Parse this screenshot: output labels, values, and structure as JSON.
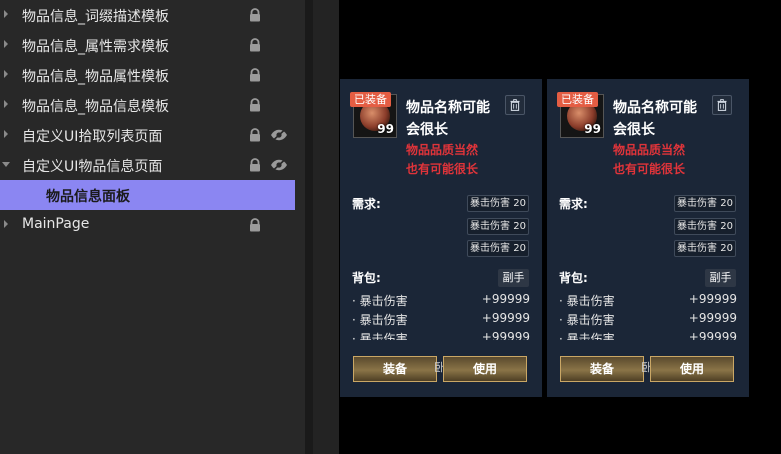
{
  "sidebar": {
    "items": [
      {
        "label": "物品信息_词缀描述模板"
      },
      {
        "label": "物品信息_属性需求模板"
      },
      {
        "label": "物品信息_物品属性模板"
      },
      {
        "label": "物品信息_物品信息模板"
      },
      {
        "label": "自定义UI拾取列表页面"
      },
      {
        "label": "自定义UI物品信息页面"
      },
      {
        "label": "物品信息面板"
      },
      {
        "label": "MainPage"
      }
    ]
  },
  "cards": [
    {
      "equipped_badge": "已装备",
      "quantity": "99",
      "name": "物品名称可能会很长",
      "quality_line1": "物品品质当然",
      "quality_line2": "也有可能很长",
      "requirements_label": "需求:",
      "requirements": [
        "暴击伤害 20",
        "暴击伤害 20",
        "暴击伤害 20"
      ],
      "bag_label": "背包:",
      "sub_badge": "副手",
      "stats": [
        {
          "name": "· 暴击伤害",
          "value": "+99999"
        },
        {
          "name": "· 暴击伤害",
          "value": "+99999"
        },
        {
          "name": "· 暴击伤害",
          "value": "+99999"
        }
      ],
      "equip_button": "装备",
      "button_fragment": "卧",
      "use_button": "使用"
    },
    {
      "equipped_badge": "已装备",
      "quantity": "99",
      "name": "物品名称可能会很长",
      "quality_line1": "物品品质当然",
      "quality_line2": "也有可能很长",
      "requirements_label": "需求:",
      "requirements": [
        "暴击伤害 20",
        "暴击伤害 20",
        "暴击伤害 20"
      ],
      "bag_label": "背包:",
      "sub_badge": "副手",
      "stats": [
        {
          "name": "· 暴击伤害",
          "value": "+99999"
        },
        {
          "name": "· 暴击伤害",
          "value": "+99999"
        },
        {
          "name": "· 暴击伤害",
          "value": "+99999"
        }
      ],
      "equip_button": "装备",
      "button_fragment": "卧",
      "use_button": "使用"
    }
  ],
  "colors": {
    "sidebar_bg": "#282828",
    "selection": "#8b86f2",
    "card_bg": "#1b2637",
    "quality_red": "#e0343a",
    "equipped_badge": "#e45d43",
    "button_gold": "#caa765"
  }
}
